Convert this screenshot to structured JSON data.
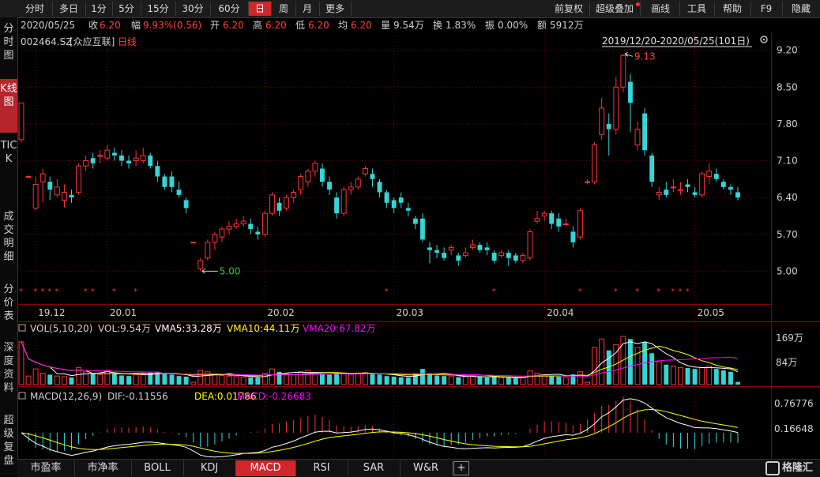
{
  "toolbar": {
    "left_items": [
      "分时",
      "多日",
      "1分",
      "5分",
      "15分",
      "30分",
      "60分",
      "日",
      "周",
      "月",
      "更多"
    ],
    "active": "日",
    "right_items": [
      "前复权",
      "超级叠加",
      "画线",
      "工具",
      "帮助",
      "F9",
      "隐藏"
    ]
  },
  "sidebar": {
    "items": [
      "分时图",
      "K线图",
      "TICK",
      "成交明细",
      "分价表",
      "深度资料",
      "超级复盘"
    ],
    "active": "K线图"
  },
  "quote": {
    "date": "2020/05/25",
    "close_label": "收",
    "close": "6.20",
    "change_label": "幅",
    "change": "9.93%(0.56)",
    "open_label": "开",
    "open": "6.20",
    "high_label": "高",
    "high": "6.20",
    "low_label": "低",
    "low": "6.20",
    "avg_label": "均",
    "avg": "6.20",
    "volume_label": "量",
    "volume": "9.54万",
    "turnover_label": "换",
    "turnover": "1.83%",
    "amplitude_label": "振",
    "amplitude": "0.00%",
    "amount_label": "额",
    "amount": "5912万"
  },
  "stock": {
    "code": "002464.SZ",
    "name": "[众应互联]",
    "period": "日线"
  },
  "range_label": "2019/12/20-2020/05/25(101日)",
  "volume_panel": {
    "title": "VOL(5,10,20)",
    "vol": "VOL:9.54万",
    "vma5": "VMA5:33.28万",
    "vma10": "VMA10:44.11万",
    "vma20": "VMA20:67.82万"
  },
  "macd_panel": {
    "title": "MACD(12,26,9)",
    "dif": "DIF:-0.11556",
    "dea": "DEA:0.01786",
    "macd": "MACD:-0.26683"
  },
  "bottom_tabs": [
    "市盈率",
    "市净率",
    "BOLL",
    "KDJ",
    "MACD",
    "RSI",
    "SAR",
    "W&R",
    "+"
  ],
  "bottom_active": "MACD",
  "watermark": "格隆汇",
  "colors": {
    "up": "#ff3232",
    "down": "#33d6d6",
    "vma5": "#ffffff",
    "vma10": "#ffff00",
    "vma20": "#ff00ff",
    "grid": "#8b0000"
  },
  "chart_data": {
    "type": "candlestick",
    "y_ticks": [
      "9.20",
      "8.50",
      "7.80",
      "7.10",
      "6.40",
      "5.70",
      "5.00"
    ],
    "ylim": [
      4.45,
      9.45
    ],
    "x_labels": [
      "19.12",
      "20.01",
      "20.02",
      "20.03",
      "20.04",
      "20.05"
    ],
    "high_marker": "9.13",
    "low_marker": "5.00",
    "volume_ticks": [
      "169万",
      "84万"
    ],
    "macd_ticks": [
      "0.76776",
      "0.16648"
    ],
    "candles": [
      [
        7.5,
        8.2,
        8.2,
        7.45
      ],
      [
        6.8,
        6.8,
        6.82,
        6.78
      ],
      [
        6.2,
        6.65,
        6.8,
        6.15
      ],
      [
        6.7,
        6.85,
        6.95,
        6.3
      ],
      [
        6.7,
        6.55,
        6.8,
        6.35
      ],
      [
        6.45,
        6.6,
        6.75,
        6.4
      ],
      [
        6.35,
        6.5,
        6.65,
        6.2
      ],
      [
        6.45,
        6.4,
        6.55,
        6.3
      ],
      [
        6.5,
        7.0,
        7.05,
        6.45
      ],
      [
        7.0,
        7.1,
        7.2,
        6.9
      ],
      [
        7.15,
        7.05,
        7.25,
        6.95
      ],
      [
        7.2,
        7.2,
        7.3,
        7.05
      ],
      [
        7.15,
        7.3,
        7.4,
        7.1
      ],
      [
        7.25,
        7.2,
        7.35,
        7.1
      ],
      [
        7.2,
        7.1,
        7.3,
        7.0
      ],
      [
        7.1,
        7.05,
        7.2,
        6.95
      ],
      [
        7.1,
        7.15,
        7.3,
        7.0
      ],
      [
        7.1,
        7.2,
        7.35,
        7.05
      ],
      [
        7.2,
        7.0,
        7.25,
        6.95
      ],
      [
        7.0,
        6.8,
        7.1,
        6.7
      ],
      [
        6.8,
        6.6,
        6.85,
        6.55
      ],
      [
        6.8,
        6.6,
        6.9,
        6.5
      ],
      [
        6.55,
        6.45,
        6.7,
        6.4
      ],
      [
        6.35,
        6.2,
        6.4,
        6.1
      ],
      [
        5.55,
        5.55,
        5.55,
        5.55
      ],
      [
        5.05,
        5.2,
        5.25,
        5.0
      ],
      [
        5.25,
        5.55,
        5.6,
        5.2
      ],
      [
        5.55,
        5.7,
        5.75,
        5.4
      ],
      [
        5.65,
        5.8,
        5.85,
        5.55
      ],
      [
        5.8,
        5.85,
        5.95,
        5.7
      ],
      [
        5.85,
        5.9,
        6.0,
        5.8
      ],
      [
        5.9,
        5.95,
        6.05,
        5.85
      ],
      [
        5.9,
        5.8,
        6.0,
        5.7
      ],
      [
        5.75,
        5.7,
        5.85,
        5.6
      ],
      [
        5.7,
        6.1,
        6.15,
        5.65
      ],
      [
        6.1,
        6.45,
        6.5,
        6.05
      ],
      [
        6.3,
        6.15,
        6.4,
        6.05
      ],
      [
        6.2,
        6.4,
        6.45,
        6.15
      ],
      [
        6.4,
        6.5,
        6.55,
        6.3
      ],
      [
        6.55,
        6.8,
        6.85,
        6.45
      ],
      [
        6.7,
        6.9,
        6.95,
        6.6
      ],
      [
        6.9,
        7.05,
        7.1,
        6.8
      ],
      [
        6.95,
        6.7,
        7.05,
        6.6
      ],
      [
        6.7,
        6.55,
        6.8,
        6.45
      ],
      [
        6.4,
        6.1,
        6.5,
        6.0
      ],
      [
        6.1,
        6.55,
        6.6,
        6.05
      ],
      [
        6.55,
        6.6,
        6.7,
        6.45
      ],
      [
        6.6,
        6.75,
        6.8,
        6.55
      ],
      [
        6.85,
        6.95,
        7.0,
        6.8
      ],
      [
        6.85,
        6.75,
        6.95,
        6.6
      ],
      [
        6.7,
        6.5,
        6.75,
        6.4
      ],
      [
        6.5,
        6.3,
        6.55,
        6.2
      ],
      [
        6.35,
        6.2,
        6.4,
        6.1
      ],
      [
        6.4,
        6.3,
        6.5,
        6.2
      ],
      [
        6.2,
        6.15,
        6.3,
        6.05
      ],
      [
        6.0,
        5.9,
        6.05,
        5.8
      ],
      [
        6.0,
        5.6,
        6.1,
        5.55
      ],
      [
        5.45,
        5.4,
        5.55,
        5.15
      ],
      [
        5.4,
        5.35,
        5.5,
        5.25
      ],
      [
        5.35,
        5.25,
        5.45,
        5.2
      ],
      [
        5.4,
        5.45,
        5.5,
        5.3
      ],
      [
        5.3,
        5.2,
        5.35,
        5.1
      ],
      [
        5.3,
        5.35,
        5.45,
        5.25
      ],
      [
        5.45,
        5.5,
        5.6,
        5.4
      ],
      [
        5.5,
        5.4,
        5.55,
        5.35
      ],
      [
        5.45,
        5.4,
        5.55,
        5.3
      ],
      [
        5.35,
        5.2,
        5.4,
        5.15
      ],
      [
        5.3,
        5.35,
        5.4,
        5.25
      ],
      [
        5.35,
        5.25,
        5.4,
        5.1
      ],
      [
        5.3,
        5.2,
        5.35,
        5.15
      ],
      [
        5.2,
        5.3,
        5.35,
        5.15
      ],
      [
        5.25,
        5.75,
        5.8,
        5.2
      ],
      [
        5.95,
        6.0,
        6.15,
        5.9
      ],
      [
        6.05,
        6.1,
        6.15,
        5.95
      ],
      [
        6.1,
        5.9,
        6.15,
        5.8
      ],
      [
        6.0,
        5.85,
        6.1,
        5.75
      ],
      [
        5.9,
        5.9,
        6.0,
        5.85
      ],
      [
        5.75,
        5.55,
        5.85,
        5.45
      ],
      [
        5.65,
        6.15,
        6.2,
        5.6
      ],
      [
        6.7,
        6.7,
        6.75,
        6.65
      ],
      [
        6.7,
        7.4,
        7.45,
        6.65
      ],
      [
        7.6,
        8.1,
        8.3,
        7.5
      ],
      [
        7.8,
        7.7,
        8.0,
        7.2
      ],
      [
        7.7,
        8.5,
        8.7,
        7.6
      ],
      [
        8.5,
        9.1,
        9.13,
        8.4
      ],
      [
        8.6,
        8.2,
        8.75,
        7.65
      ],
      [
        7.4,
        7.7,
        7.85,
        7.3
      ],
      [
        8.0,
        7.3,
        8.1,
        7.2
      ],
      [
        7.2,
        6.7,
        7.25,
        6.6
      ],
      [
        6.45,
        6.5,
        6.6,
        6.35
      ],
      [
        6.55,
        6.45,
        6.7,
        6.4
      ],
      [
        6.6,
        6.6,
        6.75,
        6.5
      ],
      [
        6.55,
        6.55,
        6.7,
        6.45
      ],
      [
        6.65,
        6.6,
        6.75,
        6.5
      ],
      [
        6.5,
        6.45,
        6.6,
        6.4
      ],
      [
        6.45,
        6.85,
        6.9,
        6.4
      ],
      [
        6.8,
        6.9,
        7.05,
        6.65
      ],
      [
        6.85,
        6.75,
        6.95,
        6.7
      ],
      [
        6.7,
        6.6,
        6.75,
        6.55
      ],
      [
        6.6,
        6.55,
        6.65,
        6.45
      ],
      [
        6.5,
        6.4,
        6.6,
        6.35
      ]
    ],
    "volume": [
      150,
      30,
      55,
      40,
      35,
      30,
      28,
      25,
      60,
      45,
      40,
      35,
      50,
      38,
      32,
      30,
      35,
      38,
      42,
      45,
      40,
      35,
      30,
      28,
      8,
      50,
      45,
      38,
      32,
      30,
      28,
      26,
      25,
      24,
      40,
      55,
      45,
      38,
      35,
      45,
      50,
      42,
      38,
      35,
      40,
      38,
      36,
      40,
      42,
      38,
      35,
      30,
      28,
      26,
      25,
      40,
      55,
      40,
      32,
      30,
      28,
      26,
      28,
      30,
      28,
      25,
      26,
      25,
      24,
      22,
      26,
      48,
      40,
      35,
      30,
      28,
      25,
      36,
      45,
      8,
      130,
      160,
      120,
      140,
      169,
      160,
      130,
      150,
      110,
      80,
      70,
      65,
      60,
      58,
      55,
      60,
      65,
      55,
      50,
      45,
      9.54
    ]
  }
}
